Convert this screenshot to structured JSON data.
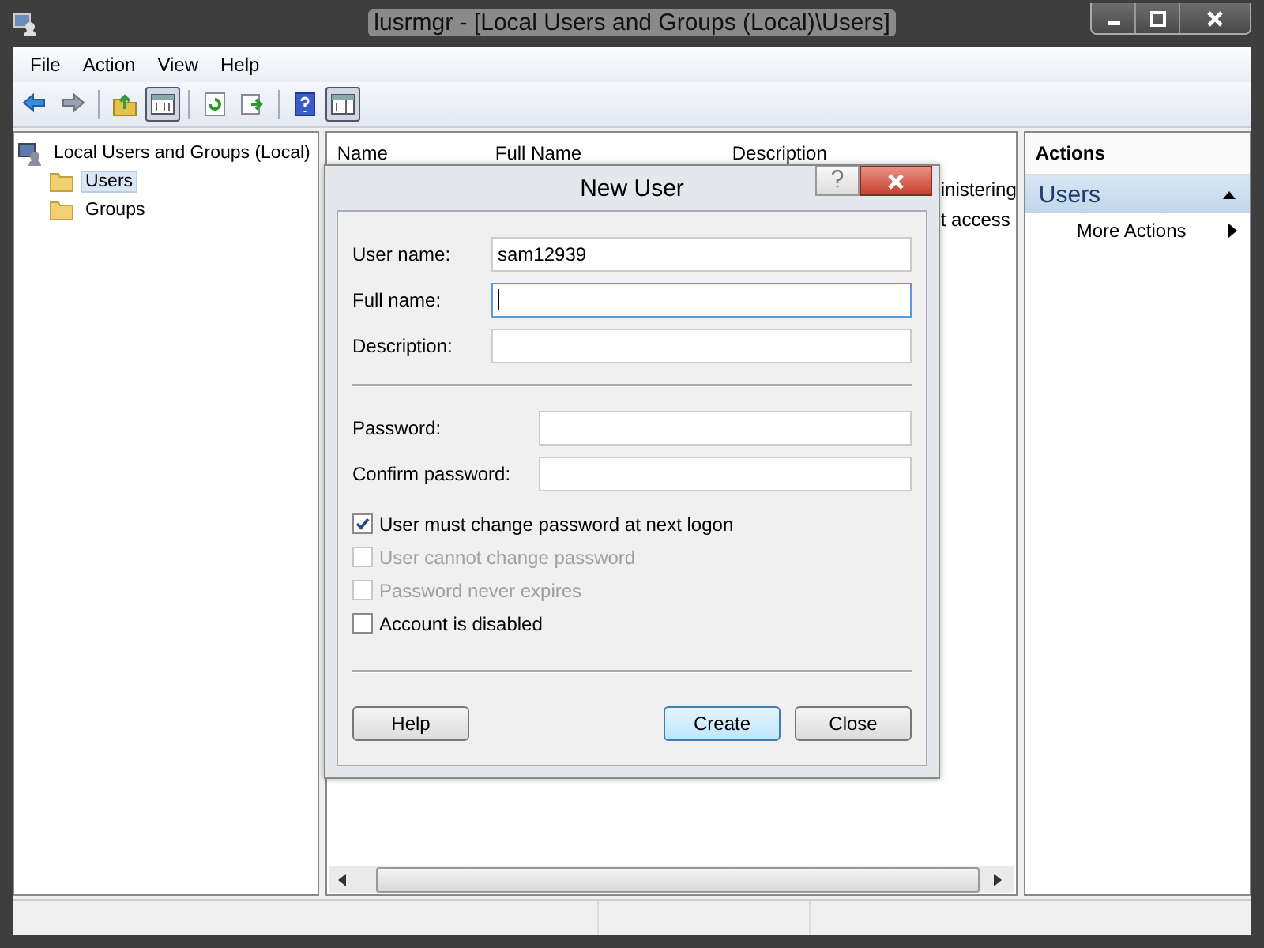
{
  "window": {
    "title": "lusrmgr - [Local Users and Groups (Local)\\Users]"
  },
  "menu": [
    "File",
    "Action",
    "View",
    "Help"
  ],
  "toolbar": [
    {
      "kind": "back",
      "pressed": false
    },
    {
      "kind": "forward",
      "pressed": false
    },
    {
      "kind": "sep"
    },
    {
      "kind": "up",
      "pressed": false
    },
    {
      "kind": "tree",
      "pressed": true
    },
    {
      "kind": "sep"
    },
    {
      "kind": "refresh",
      "pressed": false
    },
    {
      "kind": "export",
      "pressed": false
    },
    {
      "kind": "sep"
    },
    {
      "kind": "help",
      "pressed": false
    },
    {
      "kind": "pane",
      "pressed": true
    }
  ],
  "tree": {
    "label": "Local Users and Groups (Local)",
    "children": [
      {
        "label": "Users",
        "selected": true
      },
      {
        "label": "Groups",
        "selected": false
      }
    ]
  },
  "list": {
    "columns": [
      "Name",
      "Full Name",
      "Description"
    ],
    "rows": [
      {
        "description": "inistering"
      },
      {
        "description": "t access"
      }
    ]
  },
  "actions": {
    "title": "Actions",
    "section": {
      "label": "Users",
      "expanded": true
    },
    "items": [
      "More Actions"
    ]
  },
  "dialog": {
    "title": "New User",
    "account_fields": [
      {
        "label": "User name:",
        "value": "sam12939",
        "focused": false
      },
      {
        "label": "Full name:",
        "focused": true
      },
      {
        "label": "Description:",
        "focused": false
      }
    ],
    "password_fields": [
      {
        "label": "Password:",
        "focused": false
      },
      {
        "label": "Confirm password:",
        "focused": false
      }
    ],
    "checkboxes": [
      {
        "label": "User must change password at next logon",
        "checked": true,
        "disabled": false
      },
      {
        "label": "User cannot change password",
        "checked": false,
        "disabled": true
      },
      {
        "label": "Password never expires",
        "checked": false,
        "disabled": true
      },
      {
        "label": "Account is disabled",
        "checked": false,
        "disabled": false
      }
    ],
    "buttons": [
      {
        "label": "Help",
        "default": false
      },
      {
        "label": "Create",
        "default": true
      },
      {
        "label": "Close",
        "default": false
      }
    ]
  }
}
